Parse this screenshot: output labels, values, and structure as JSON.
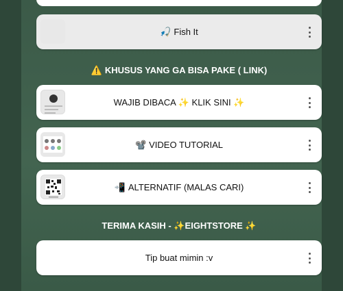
{
  "links": [
    {
      "label": "Fish It",
      "icon": "person-fishing-emoji",
      "emoji": "🎣"
    },
    {
      "label": "WAJIB DIBACA ✨ KLIK SINI ✨",
      "icon": "",
      "emoji": ""
    },
    {
      "label": "VIDEO TUTORIAL",
      "icon": "video-camera-emoji",
      "emoji": "📽️"
    },
    {
      "label": "ALTERNATIF (MALAS CARI)",
      "icon": "phone-arrow-emoji",
      "emoji": "📲"
    },
    {
      "label": "Tip buat mimin :v",
      "icon": "",
      "emoji": ""
    }
  ],
  "headings": {
    "khusus": {
      "emoji": "⚠️",
      "text": "KHUSUS YANG GA BISA PAKE ( LINK)"
    },
    "terima": {
      "text": "TERIMA KASIH - ✨EIGHTSTORE ✨"
    }
  },
  "colors": {
    "background": "#2f4a3a",
    "card": "#ffffff",
    "card_highlight": "#ebebeb"
  }
}
